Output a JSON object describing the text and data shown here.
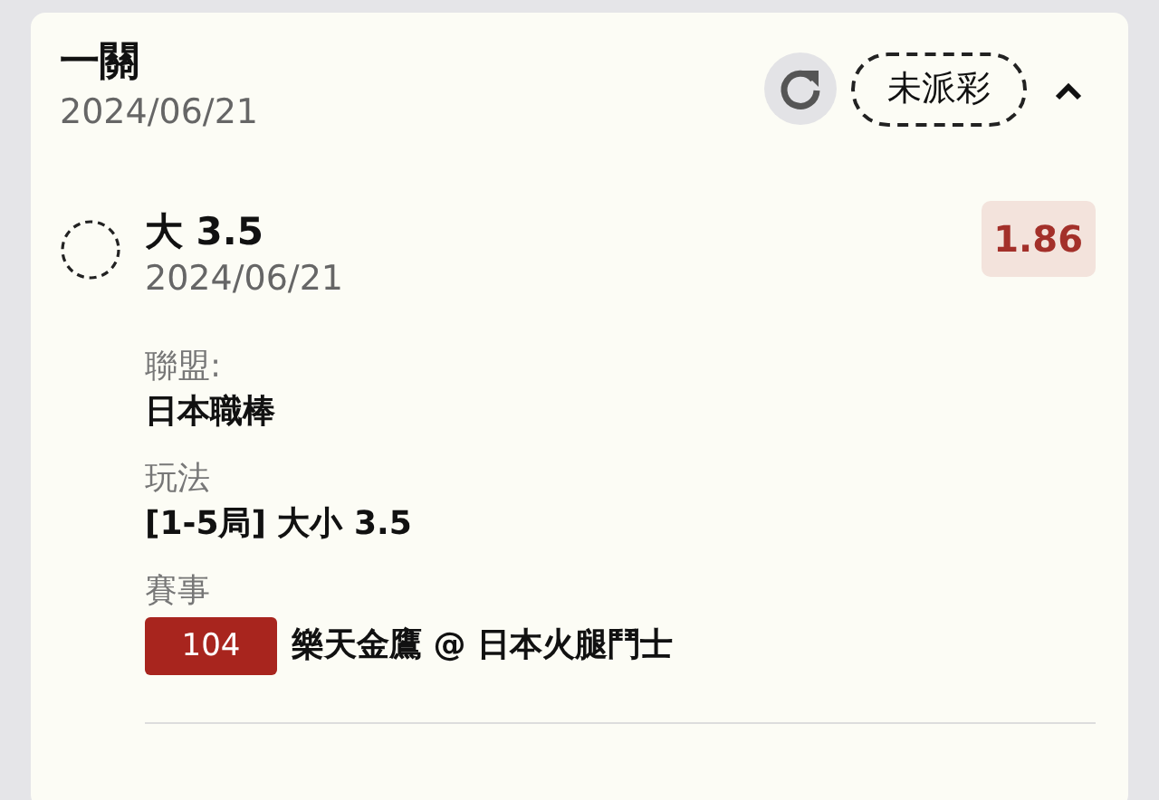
{
  "bet": {
    "title": "一關",
    "date": "2024/06/21",
    "status": "未派彩",
    "expanded": true
  },
  "legs": [
    {
      "selection": "大 3.5",
      "date": "2024/06/21",
      "odds": "1.86",
      "fields": [
        {
          "label": "聯盟:",
          "value": "日本職棒"
        },
        {
          "label": "玩法",
          "value": "[1-5局] 大小 3.5"
        },
        {
          "label": "賽事",
          "badge": "104",
          "value": "樂天金鷹 @ 日本火腿鬥士"
        }
      ]
    }
  ]
}
